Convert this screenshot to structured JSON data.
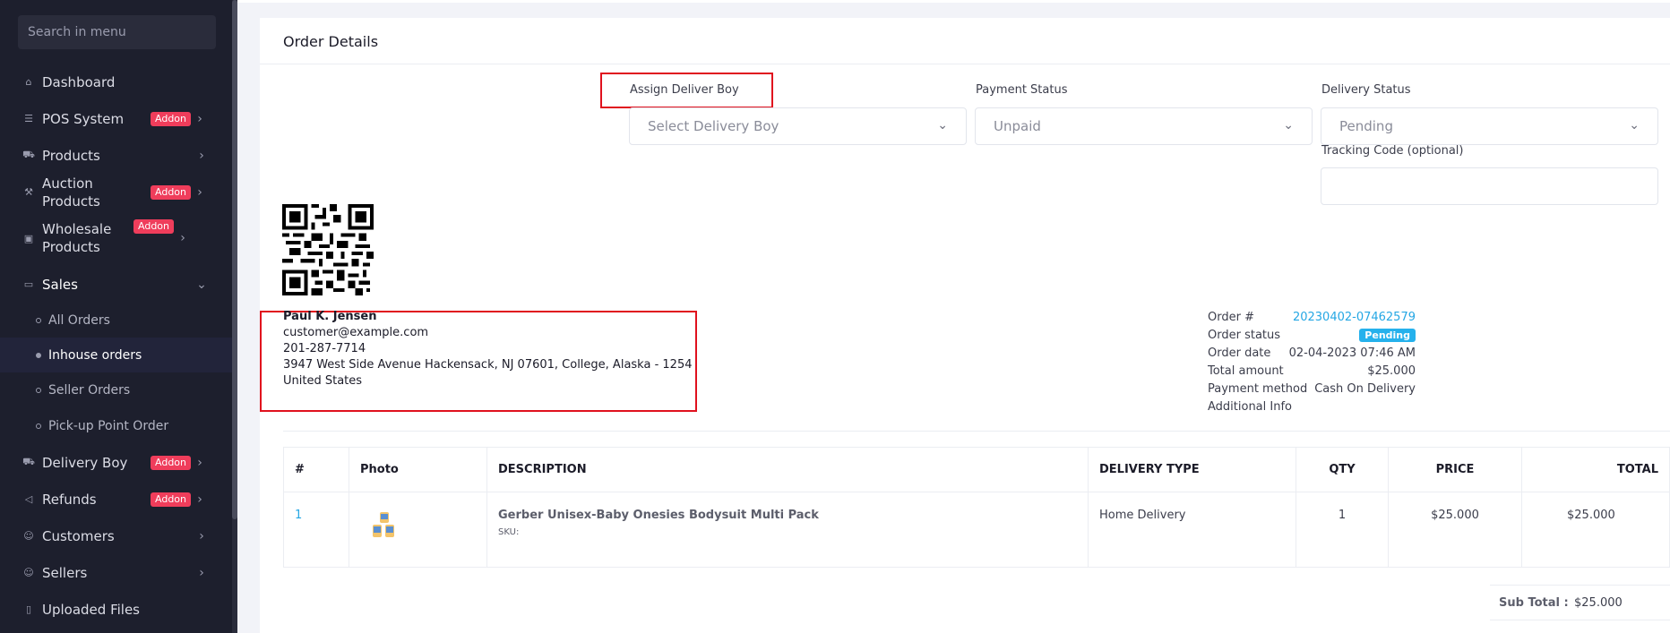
{
  "sidebar": {
    "search_placeholder": "Search in menu",
    "items": [
      {
        "label": "Dashboard",
        "icon": "home-icon"
      },
      {
        "label": "POS System",
        "icon": "list-icon",
        "badge": "Addon"
      },
      {
        "label": "Products",
        "icon": "cart-icon"
      },
      {
        "label": "Auction Products",
        "icon": "gavel-icon",
        "badge": "Addon"
      },
      {
        "label": "Wholesale Products",
        "icon": "box-icon",
        "badge": "Addon"
      },
      {
        "label": "Sales",
        "icon": "money-icon"
      },
      {
        "label": "Delivery Boy",
        "icon": "truck-icon",
        "badge": "Addon"
      },
      {
        "label": "Refunds",
        "icon": "refund-icon",
        "badge": "Addon"
      },
      {
        "label": "Customers",
        "icon": "users-icon"
      },
      {
        "label": "Sellers",
        "icon": "user-icon"
      },
      {
        "label": "Uploaded Files",
        "icon": "file-icon"
      }
    ],
    "sales_sub": [
      "All Orders",
      "Inhouse orders",
      "Seller Orders",
      "Pick-up Point Order"
    ]
  },
  "card": {
    "title": "Order Details",
    "assign_label": "Assign Deliver Boy",
    "assign_placeholder": "Select Delivery Boy",
    "payment_label": "Payment Status",
    "payment_value": "Unpaid",
    "delivery_label": "Delivery Status",
    "delivery_value": "Pending",
    "tracking_label": "Tracking Code (optional)"
  },
  "customer": {
    "name": "Paul K. Jensen",
    "email": "customer@example.com",
    "phone": "201-287-7714",
    "address": "3947 West Side Avenue Hackensack, NJ 07601, College, Alaska - 1254",
    "country": "United States"
  },
  "order": {
    "number_label": "Order #",
    "number": "20230402-07462579",
    "status_label": "Order status",
    "status": "Pending",
    "date_label": "Order date",
    "date": "02-04-2023 07:46 AM",
    "total_label": "Total amount",
    "total": "$25.000",
    "payment_label": "Payment method",
    "payment": "Cash On Delivery",
    "additional_label": "Additional Info"
  },
  "table": {
    "headers": [
      "#",
      "Photo",
      "DESCRIPTION",
      "DELIVERY TYPE",
      "QTY",
      "PRICE",
      "TOTAL"
    ],
    "rows": [
      {
        "index": "1",
        "name": "Gerber Unisex-Baby Onesies Bodysuit Multi Pack",
        "sku": "SKU:",
        "delivery": "Home Delivery",
        "qty": "1",
        "price": "$25.000",
        "total": "$25.000"
      }
    ]
  },
  "subtotal": {
    "label": "Sub Total :",
    "value": "$25.000"
  },
  "colors": {
    "accent": "#25a7e4",
    "badge": "#ef3d5b",
    "sidebar": "#1d1f2d",
    "highlight": "#e0111e"
  }
}
